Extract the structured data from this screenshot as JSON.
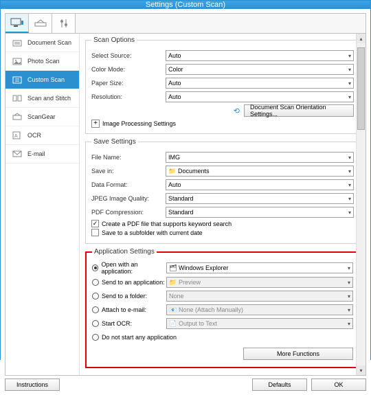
{
  "title": "Settings (Custom Scan)",
  "sidebar": {
    "items": [
      {
        "label": "Document Scan"
      },
      {
        "label": "Photo Scan"
      },
      {
        "label": "Custom Scan"
      },
      {
        "label": "Scan and Stitch"
      },
      {
        "label": "ScanGear"
      },
      {
        "label": "OCR"
      },
      {
        "label": "E-mail"
      }
    ]
  },
  "scan_options": {
    "legend": "Scan Options",
    "select_source_label": "Select Source:",
    "select_source_value": "Auto",
    "color_mode_label": "Color Mode:",
    "color_mode_value": "Color",
    "paper_size_label": "Paper Size:",
    "paper_size_value": "Auto",
    "resolution_label": "Resolution:",
    "resolution_value": "Auto",
    "orientation_btn": "Document Scan Orientation Settings...",
    "expander_label": "Image Processing Settings"
  },
  "save_settings": {
    "legend": "Save Settings",
    "file_name_label": "File Name:",
    "file_name_value": "IMG",
    "save_in_label": "Save in:",
    "save_in_value": "Documents",
    "data_format_label": "Data Format:",
    "data_format_value": "Auto",
    "jpeg_quality_label": "JPEG Image Quality:",
    "jpeg_quality_value": "Standard",
    "pdf_compression_label": "PDF Compression:",
    "pdf_compression_value": "Standard",
    "chk_keyword": "Create a PDF file that supports keyword search",
    "chk_subfolder": "Save to a subfolder with current date"
  },
  "app_settings": {
    "legend": "Application Settings",
    "open_with_label": "Open with an application:",
    "open_with_value": "Windows Explorer",
    "send_to_app_label": "Send to an application:",
    "send_to_app_value": "Preview",
    "send_to_folder_label": "Send to a folder:",
    "send_to_folder_value": "None",
    "attach_email_label": "Attach to e-mail:",
    "attach_email_value": "None (Attach Manually)",
    "start_ocr_label": "Start OCR:",
    "start_ocr_value": "Output to Text",
    "do_not_start_label": "Do not start any application",
    "more_functions_btn": "More Functions"
  },
  "footer": {
    "instructions": "Instructions",
    "defaults": "Defaults",
    "ok": "OK"
  }
}
